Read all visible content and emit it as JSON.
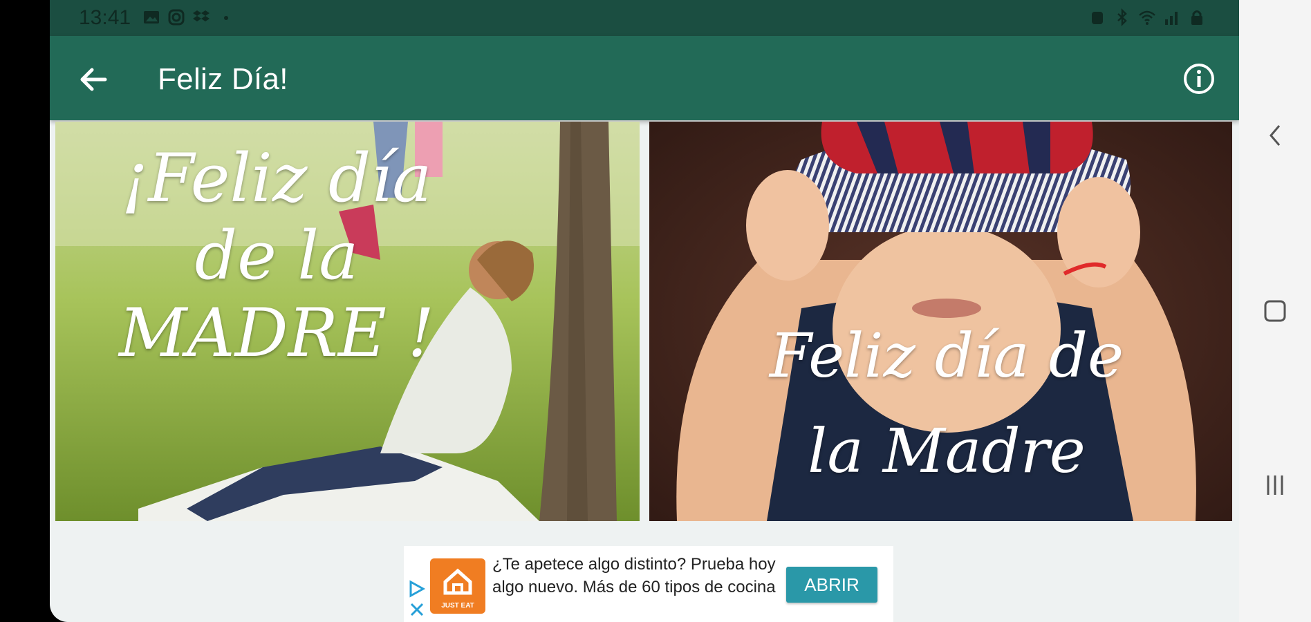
{
  "status_bar": {
    "time": "13:41",
    "left_icons": [
      "gallery-icon",
      "instagram-icon",
      "dropbox-icon",
      "dot-icon"
    ],
    "right_icons": [
      "alarm-icon",
      "bluetooth-icon",
      "wifi-icon",
      "signal-icon",
      "lock-icon"
    ]
  },
  "app_bar": {
    "title": "Feliz Día!",
    "back_icon": "arrow-back-icon",
    "info_icon": "info-icon"
  },
  "cards": [
    {
      "greeting_lines": [
        "¡Feliz día",
        "de la",
        "MADRE !"
      ]
    },
    {
      "greeting_lines": [
        "Feliz día de",
        "la Madre"
      ]
    }
  ],
  "ad": {
    "text": "¿Te apetece algo distinto? Prueba hoy algo nuevo. Más de 60 tipos de cocina",
    "cta": "ABRIR",
    "logo_caption": "JUST EAT"
  },
  "nav_bar": {
    "icons": [
      "back-chevron-icon",
      "home-square-icon",
      "recents-icon"
    ]
  },
  "colors": {
    "status_bar": "#1b4e41",
    "app_bar": "#226a57",
    "ad_button": "#2a98a8",
    "ad_logo": "#f07d22"
  }
}
